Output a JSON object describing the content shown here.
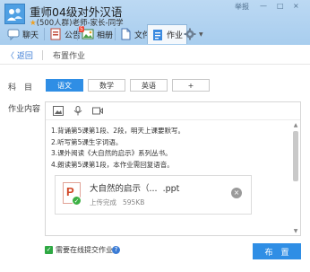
{
  "window": {
    "title": "重师04级对外汉语",
    "subtitle_star": "★",
    "subtitle": "(500人群)老师-家长-同学",
    "controls": [
      "举报",
      "—",
      "□",
      "×"
    ]
  },
  "tabs": [
    {
      "label": "聊天",
      "icon": "chat-icon"
    },
    {
      "label": "公告",
      "icon": "announcement-icon"
    },
    {
      "label": "相册",
      "icon": "album-icon",
      "badge": "5"
    },
    {
      "label": "文件",
      "icon": "file-icon"
    },
    {
      "label": "作业",
      "icon": "homework-icon",
      "active": true
    },
    {
      "label": "",
      "icon": "gear-icon"
    }
  ],
  "subheader": {
    "back_label": "〈 返回",
    "title": "布置作业"
  },
  "form": {
    "subject_label": "科　目",
    "subjects": [
      "语文",
      "数学",
      "英语",
      "+"
    ],
    "active_subject": "语文",
    "content_label": "作业内容"
  },
  "editor": {
    "toolbar_icons": [
      "image-icon",
      "audio-icon",
      "video-icon"
    ],
    "lines": [
      "1.背诵第5课第1段、2段，明天上课要默写。",
      "2.听写第5课生字词语。",
      "3.课外阅读《大自然的启示》系列丛书。",
      "4.朗读第5课第1段，本作业需回复语音。"
    ],
    "attachment": {
      "name": "大自然的启示（...",
      "ext": ".ppt",
      "status": "上传完成",
      "size": "595KB"
    }
  },
  "footer": {
    "checkbox_label": "需要在线提交作业",
    "checkbox_checked": true,
    "submit_label": "布　置"
  },
  "colors": {
    "accent": "#2f8ee5",
    "header_bg": "#b6d5f1",
    "success": "#3cb043",
    "ppt": "#d24726"
  }
}
